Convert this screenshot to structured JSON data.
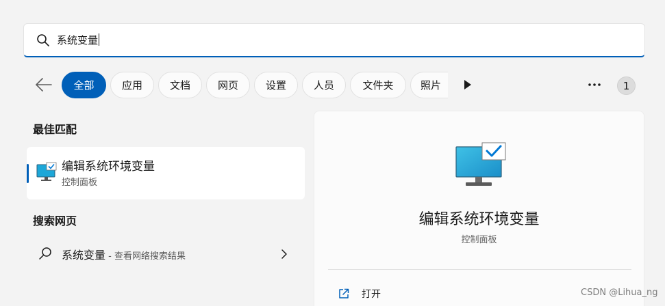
{
  "search": {
    "query": "系统变量"
  },
  "filters": [
    {
      "label": "全部",
      "active": true
    },
    {
      "label": "应用"
    },
    {
      "label": "文档"
    },
    {
      "label": "网页"
    },
    {
      "label": "设置"
    },
    {
      "label": "人员"
    },
    {
      "label": "文件夹"
    },
    {
      "label": "照片"
    }
  ],
  "badge": "1",
  "best_match": {
    "heading": "最佳匹配",
    "name": "编辑系统环境变量",
    "category": "控制面板"
  },
  "web_search": {
    "heading": "搜索网页",
    "query": "系统变量",
    "hint": " - 查看网络搜索结果"
  },
  "detail": {
    "title": "编辑系统环境变量",
    "subtitle": "控制面板",
    "actions": [
      {
        "label": "打开",
        "icon": "open-external-icon"
      }
    ]
  },
  "watermark": "CSDN @Lihua_ng",
  "colors": {
    "accent": "#005fb8",
    "background": "#f3f3f3"
  }
}
